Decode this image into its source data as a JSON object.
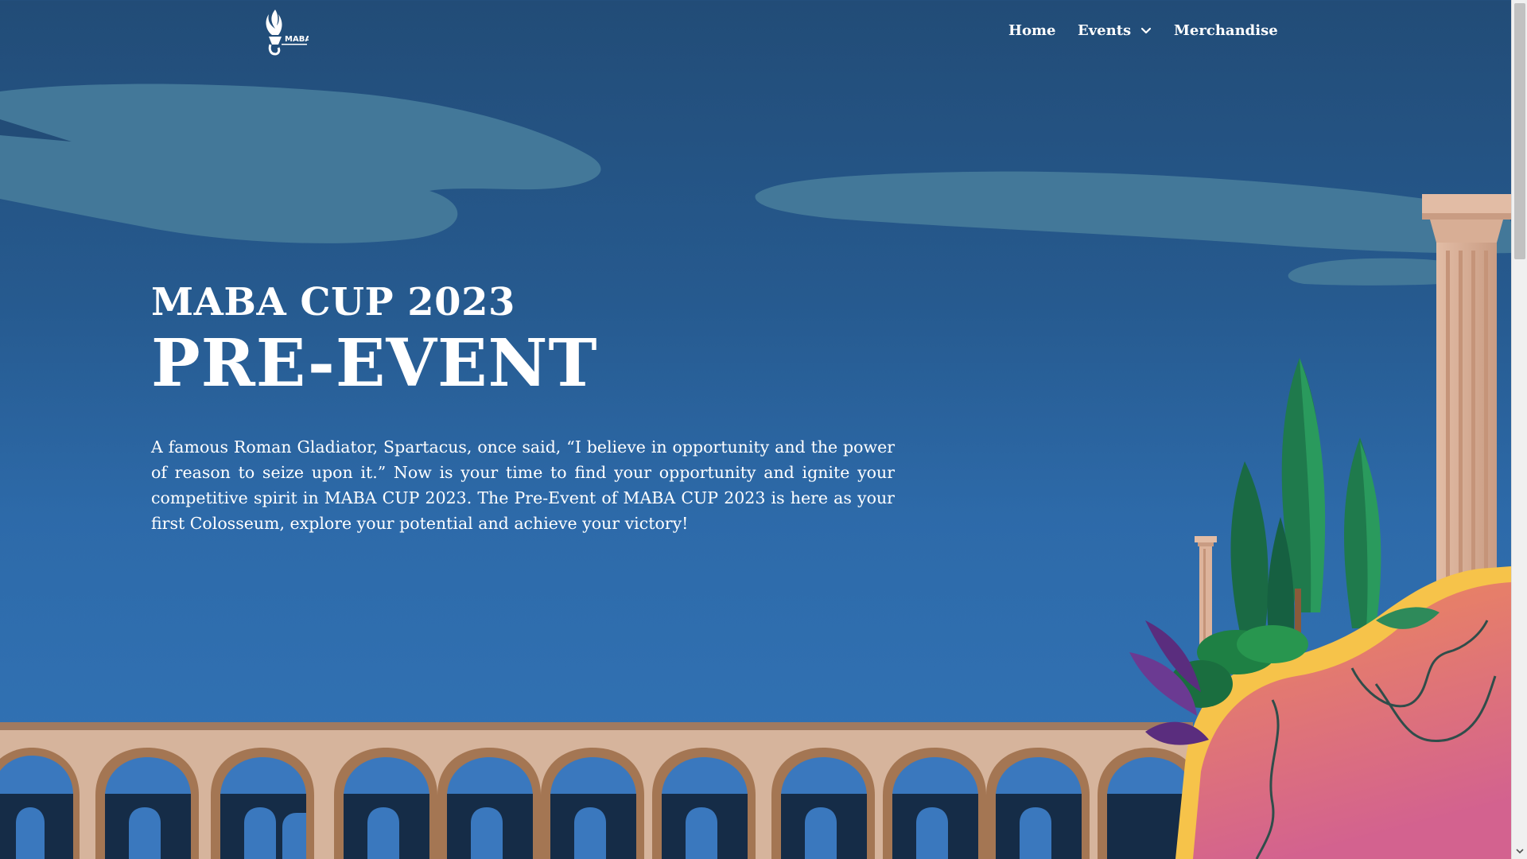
{
  "header": {
    "logo_text": "MABA CUP",
    "nav": {
      "home": "Home",
      "events": "Events",
      "merchandise": "Merchandise"
    }
  },
  "hero": {
    "kicker": "MABA CUP 2023",
    "title": "PRE-EVENT",
    "description": "A famous Roman Gladiator, Spartacus, once said, “I believe in opportunity and the power of reason to seize upon it.” Now is your time to find your opportunity and ignite your competitive spirit in MABA CUP 2023. The Pre-Event of MABA CUP 2023 is here as your first Colosseum, explore your potential and achieve your victory!"
  },
  "icons": {
    "logo": "torch-logo-icon",
    "events_dropdown": "chevron-down-icon",
    "scroll_down": "scroll-down-arrow-icon"
  },
  "colors": {
    "sky_top": "#224c77",
    "sky_bottom": "#3375b8",
    "cloud": "#437899",
    "aqueduct": "#d6b49c",
    "cliff_top": "#f3a24e",
    "cliff_bottom": "#d4628e"
  }
}
